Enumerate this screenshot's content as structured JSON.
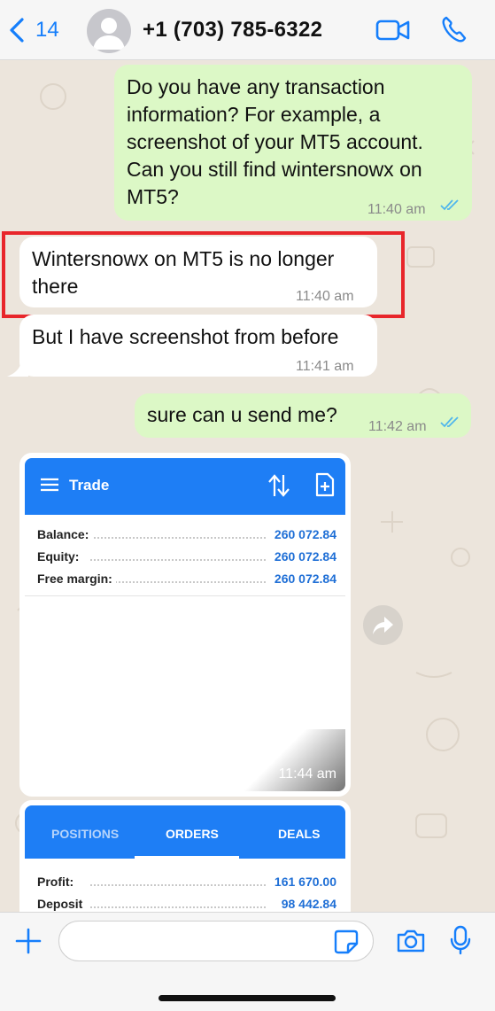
{
  "header": {
    "back_count": "14",
    "contact_name": "+1 (703) 785-6322",
    "icons": [
      "chevron-left-icon",
      "avatar-placeholder-icon",
      "video-camera-icon",
      "phone-icon"
    ]
  },
  "messages": [
    {
      "direction": "outgoing",
      "text": "Do you have any transaction information? For example, a screenshot of your MT5 account. Can you still find wintersnowx on MT5?",
      "time": "11:40 am",
      "status": "read"
    },
    {
      "direction": "incoming",
      "text": "Wintersnowx on MT5 is no longer there",
      "time": "11:40 am",
      "highlighted": true
    },
    {
      "direction": "incoming",
      "text": "But I have screenshot from before",
      "time": "11:41 am"
    },
    {
      "direction": "outgoing",
      "text": "sure can u send me?",
      "time": "11:42 am",
      "status": "read"
    }
  ],
  "image1": {
    "title": "Trade",
    "rows": [
      {
        "label": "Balance:",
        "value": "260 072.84"
      },
      {
        "label": "Equity:",
        "value": "260 072.84"
      },
      {
        "label": "Free margin:",
        "value": "260 072.84"
      }
    ],
    "time": "11:44 am"
  },
  "image2": {
    "tabs": [
      "POSITIONS",
      "ORDERS",
      "DEALS"
    ],
    "active_tab": "ORDERS",
    "rows": [
      {
        "label": "Profit:",
        "value": "161 670.00"
      },
      {
        "label": "Deposit",
        "value": "98 442.84"
      }
    ]
  },
  "colors": {
    "outgoing_bubble": "#dcf8c6",
    "incoming_bubble": "#ffffff",
    "ios_blue": "#157efb",
    "mt5_blue": "#1e7ef5",
    "highlight_red": "#e8262b",
    "read_ticks": "#4fb6ec"
  },
  "footer": {
    "input_value": "",
    "icons": [
      "plus-icon",
      "sticker-icon",
      "camera-icon",
      "microphone-icon"
    ]
  }
}
